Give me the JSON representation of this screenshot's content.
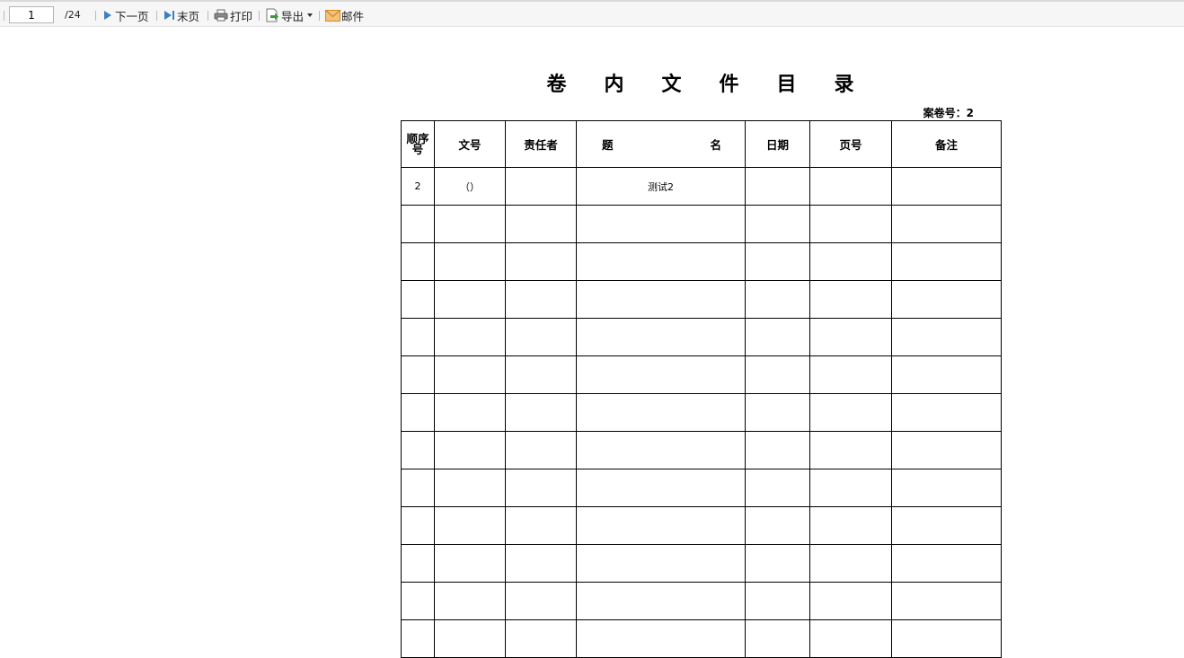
{
  "toolbar": {
    "page_input": "1",
    "total_pages": "/24",
    "next_label": "下一页",
    "last_label": "末页",
    "print_label": "打印",
    "export_label": "导出",
    "mail_label": "邮件",
    "icons": {
      "next": "play-icon",
      "last": "skip-to-end-icon",
      "print": "printer-icon",
      "export": "export-icon",
      "export_dropdown": "caret-down-icon",
      "mail": "envelope-icon"
    },
    "colors": {
      "accent": "#3b7fc4",
      "mail": "#f0a030",
      "export": "#3a9a3a"
    }
  },
  "document": {
    "title": "卷内文件目录",
    "volume_label": "案卷号：",
    "volume_value": "2",
    "headers": {
      "seq_line1": "顺序",
      "seq_line2": "号",
      "doc_no": "文号",
      "responsible": "责任者",
      "title_left": "题",
      "title_right": "名",
      "date": "日期",
      "page_no": "页号",
      "remarks": "备注"
    },
    "rows": [
      {
        "seq": "2",
        "doc_no": "（）",
        "responsible": "",
        "title": "测试2",
        "date": "",
        "page_no": "",
        "remarks": ""
      }
    ],
    "empty_rows": 12
  }
}
